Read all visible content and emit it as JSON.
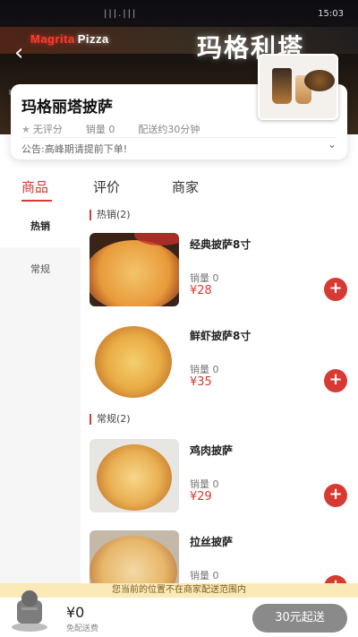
{
  "status_bar": {
    "signal": "|||.|||",
    "time": "15:03"
  },
  "header": {
    "sign_en_left": "Magrita",
    "sign_en_right": "Pizza",
    "sign_cn": "玛格利塔"
  },
  "store": {
    "name": "玛格丽塔披萨",
    "rating": "无评分",
    "sales": "销量 0",
    "delivery_time": "配送约30分钟",
    "notice": "公告:高峰期请提前下单!"
  },
  "tabs": [
    {
      "label": "商品",
      "active": true
    },
    {
      "label": "评价",
      "active": false
    },
    {
      "label": "商家",
      "active": false
    }
  ],
  "categories": [
    {
      "label": "热销",
      "active": true
    },
    {
      "label": "常规",
      "active": false
    }
  ],
  "sections": [
    {
      "title": "热销(2)",
      "items": [
        {
          "name": "经典披萨8寸",
          "sales": "销量 0",
          "price": "¥28"
        },
        {
          "name": "鲜虾披萨8寸",
          "sales": "销量 0",
          "price": "¥35"
        }
      ]
    },
    {
      "title": "常规(2)",
      "items": [
        {
          "name": "鸡肉披萨",
          "sales": "销量 0",
          "price": "¥29"
        },
        {
          "name": "拉丝披萨",
          "sales": "销量 0",
          "price": ""
        }
      ]
    }
  ],
  "bottom": {
    "banner": "您当前的位置不在商家配送范围内",
    "total": "¥0",
    "delivery_fee": "免配送费",
    "checkout_label": "30元起送"
  },
  "colors": {
    "accent": "#d63a33",
    "banner_bg": "#fbe9b8",
    "checkout_bg": "#8a8a8a"
  }
}
